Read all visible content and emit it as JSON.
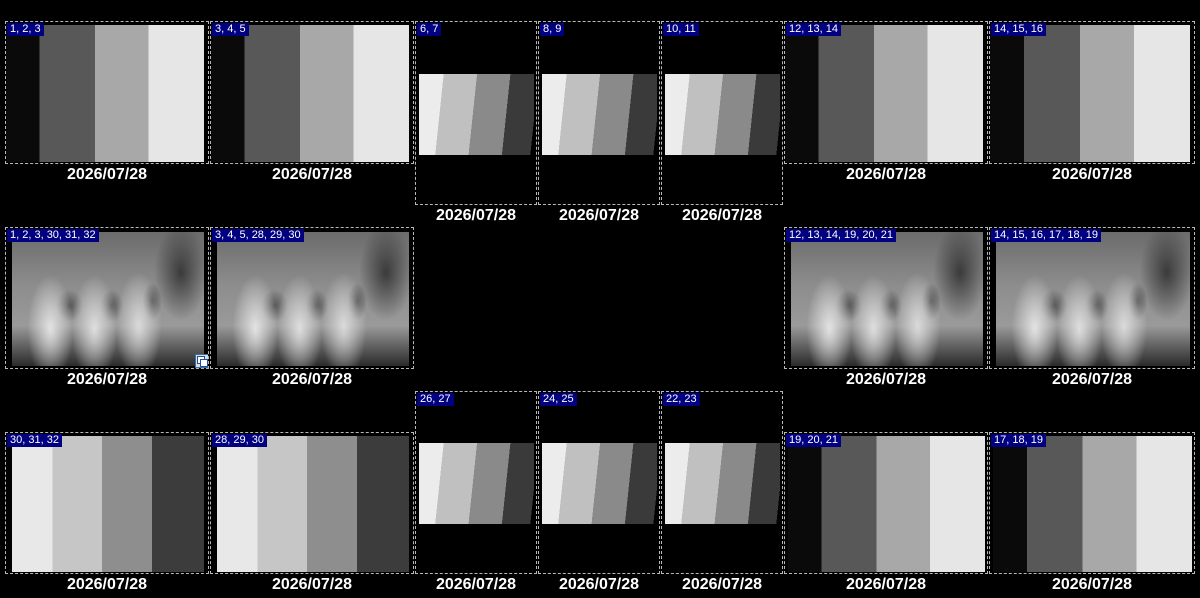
{
  "slots": [
    {
      "label": "1, 2, 3",
      "date": "2026/07/28"
    },
    {
      "label": "3, 4, 5",
      "date": "2026/07/28"
    },
    {
      "label": "6, 7",
      "date": "2026/07/28"
    },
    {
      "label": "8, 9",
      "date": "2026/07/28"
    },
    {
      "label": "10, 11",
      "date": "2026/07/28"
    },
    {
      "label": "12, 13, 14",
      "date": "2026/07/28"
    },
    {
      "label": "14, 15, 16",
      "date": "2026/07/28"
    },
    {
      "label": "1, 2, 3, 30, 31, 32",
      "date": "2026/07/28"
    },
    {
      "label": "3, 4, 5, 28, 29, 30",
      "date": "2026/07/28"
    },
    {
      "label": "12, 13, 14, 19, 20, 21",
      "date": "2026/07/28"
    },
    {
      "label": "14, 15, 16, 17, 18, 19",
      "date": "2026/07/28"
    },
    {
      "label": "30, 31, 32",
      "date": "2026/07/28"
    },
    {
      "label": "28, 29, 30",
      "date": "2026/07/28"
    },
    {
      "label": "26, 27",
      "date": "2026/07/28"
    },
    {
      "label": "24, 25",
      "date": "2026/07/28"
    },
    {
      "label": "22, 23",
      "date": "2026/07/28"
    },
    {
      "label": "19, 20, 21",
      "date": "2026/07/28"
    },
    {
      "label": "17, 18, 19",
      "date": "2026/07/28"
    }
  ],
  "icons": {
    "copy": "copy-icon"
  }
}
